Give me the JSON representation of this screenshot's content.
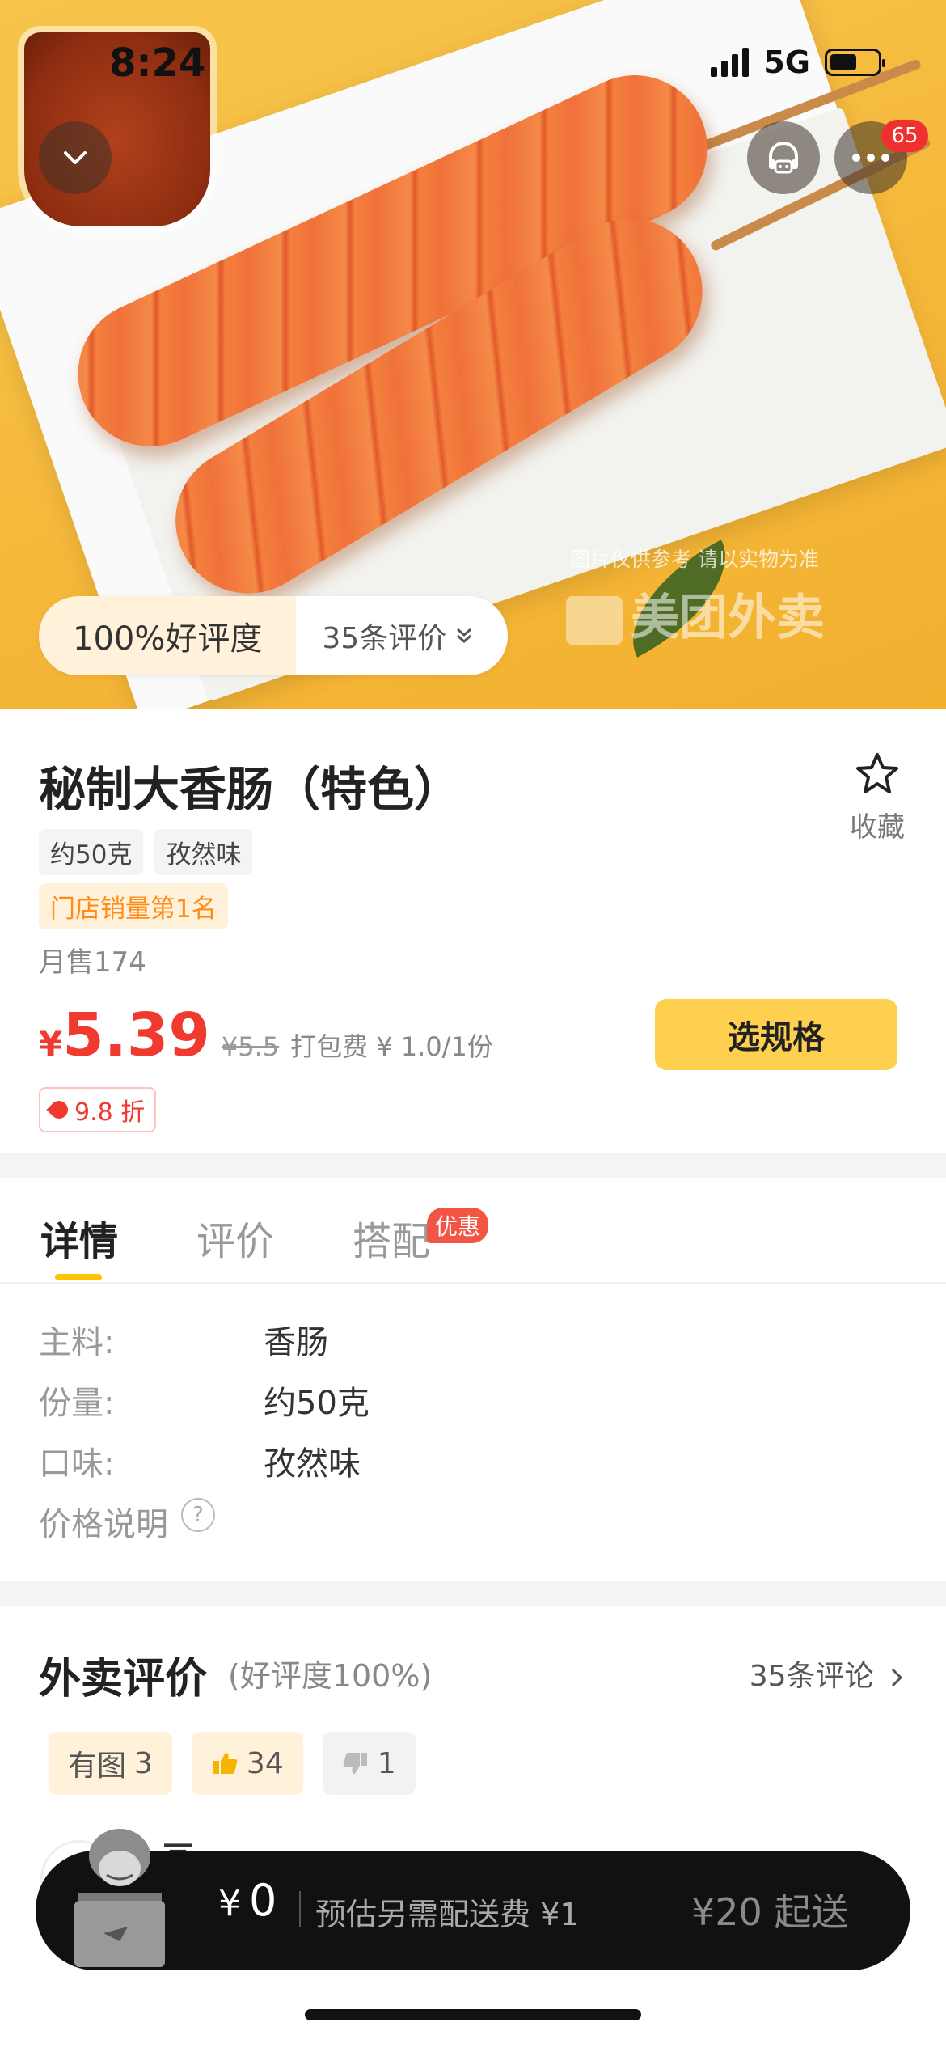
{
  "status_bar": {
    "time": "8:24",
    "network": "5G"
  },
  "hero": {
    "watermark_caption": "图片仅供参考 请以实物为准",
    "watermark_logo": "美团外卖",
    "message_badge": "65",
    "rating_pill": {
      "positive_rate": "100%好评度",
      "review_count": "35条评价"
    }
  },
  "product": {
    "title": "秘制大香肠（特色）",
    "favorite_label": "收藏",
    "tags": [
      "约50克",
      "孜然味"
    ],
    "rank_badge": "门店销量第1名",
    "monthly_sales": "月售174",
    "currency": "¥",
    "price": "5.39",
    "original_price": "¥5.5",
    "packing_fee": "打包费 ¥ 1.0/1份",
    "select_spec_button": "选规格",
    "discount": "9.8 折"
  },
  "tabs": [
    {
      "label": "详情",
      "active": true
    },
    {
      "label": "评价",
      "active": false
    },
    {
      "label": "搭配",
      "active": false,
      "badge": "优惠"
    }
  ],
  "details": [
    {
      "key": "主料:",
      "value": "香肠"
    },
    {
      "key": "份量:",
      "value": "约50克"
    },
    {
      "key": "口味:",
      "value": "孜然味"
    },
    {
      "key": "价格说明",
      "value": ""
    }
  ],
  "reviews": {
    "title": "外卖评价",
    "subtitle": "(好评度100%)",
    "count_link": "35条评论",
    "filters": [
      {
        "label": "有图",
        "count": "3"
      },
      {
        "label": "",
        "count": "34",
        "icon": "thumbs-up-icon"
      },
      {
        "label": "",
        "count": "1",
        "icon": "thumbs-down-icon"
      }
    ],
    "peek_reviewer_name": "画",
    "colors": {
      "accent": "#ffc300",
      "price": "#f03a2f",
      "badge": "#f25544"
    }
  },
  "cart": {
    "currency": "¥",
    "total": "0",
    "delivery_note": "预估另需配送费 ¥1",
    "minimum_order": "¥20 起送"
  }
}
